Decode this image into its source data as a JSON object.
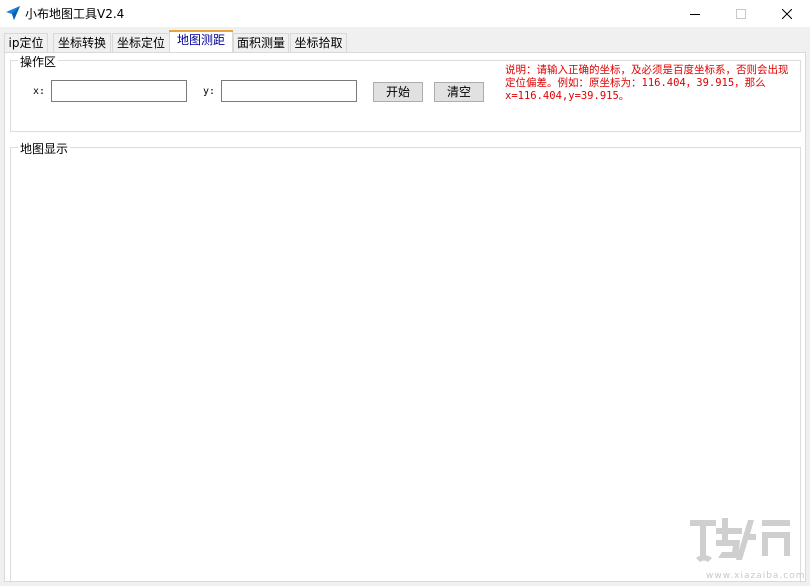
{
  "window": {
    "title": "小布地图工具V2.4",
    "controls": [
      "minimize",
      "maximize",
      "close"
    ]
  },
  "tabs": [
    {
      "label": "ip定位"
    },
    {
      "label": "坐标转换"
    },
    {
      "label": "坐标定位"
    },
    {
      "label": "地图测距",
      "active": true
    },
    {
      "label": "面积测量"
    },
    {
      "label": "坐标拾取"
    }
  ],
  "operation": {
    "group_title": "操作区",
    "x_label": "x:",
    "x_value": "",
    "y_label": "y:",
    "y_value": "",
    "start_button": "开始",
    "clear_button": "清空",
    "note": "说明：请输入正确的坐标，及必须是百度坐标系，否则会出现定位偏差。例如：原坐标为：116.404，39.915，那么x=116.404,y=39.915。"
  },
  "map": {
    "group_title": "地图显示"
  },
  "colors": {
    "note_text": "#e00000",
    "active_tab_text": "#000099",
    "active_tab_accent": "#e8a33a",
    "app_icon": "#1a7fe0"
  },
  "icons": {
    "app": "navigation-arrow-icon",
    "watermark": "download-site-logo"
  }
}
